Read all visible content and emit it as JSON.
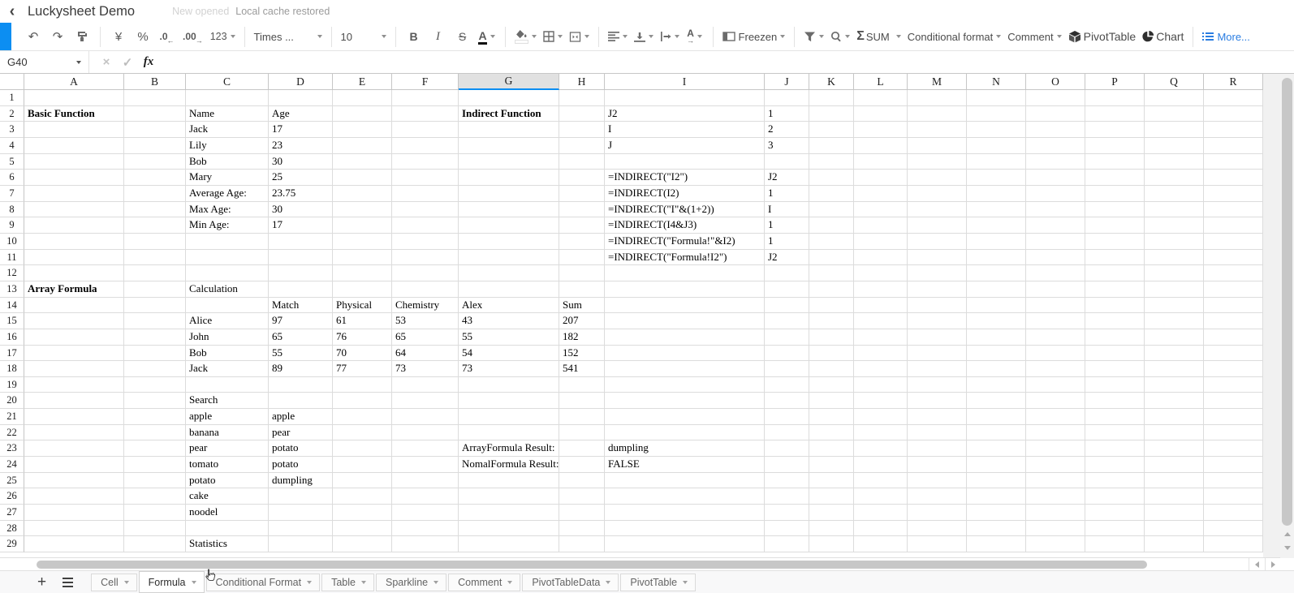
{
  "header": {
    "title": "Luckysheet Demo",
    "status_muted": "New opened",
    "status": "Local cache restored"
  },
  "icons": {
    "back": "‹",
    "undo": "↶",
    "redo": "↷",
    "currency": "¥",
    "percent": "%",
    "decimal_decrease": ".0",
    "decimal_increase": ".00",
    "arrow_left": "←",
    "arrow_right": "→",
    "number_format": "123",
    "bold": "B",
    "italic": "I",
    "strikethrough": "S",
    "font_color": "A",
    "text_rotate": "A",
    "sigma": "Σ",
    "cancel": "×",
    "confirm": "✓",
    "fx": "fx",
    "add_sheet": "+"
  },
  "toolbar": {
    "font_family": "Times ...",
    "font_size": "10",
    "freeze_label": "Freezen",
    "sum_label": "SUM",
    "conditional_label": "Conditional format",
    "comment_label": "Comment",
    "pivot_label": "PivotTable",
    "chart_label": "Chart",
    "more_label": "More..."
  },
  "formula_bar": {
    "name_box": "G40"
  },
  "grid": {
    "columns": [
      "A",
      "B",
      "C",
      "D",
      "E",
      "F",
      "G",
      "H",
      "I",
      "J",
      "K",
      "L",
      "M",
      "N",
      "O",
      "P",
      "Q",
      "R"
    ],
    "selected_column": "G",
    "row_count": 29,
    "cells": [
      {
        "r": 2,
        "c": "A",
        "v": "Basic Function",
        "b": true
      },
      {
        "r": 2,
        "c": "C",
        "v": "Name"
      },
      {
        "r": 2,
        "c": "D",
        "v": "Age"
      },
      {
        "r": 2,
        "c": "G",
        "v": "Indirect Function",
        "b": true
      },
      {
        "r": 2,
        "c": "I",
        "v": "J2"
      },
      {
        "r": 2,
        "c": "J",
        "v": "1"
      },
      {
        "r": 3,
        "c": "C",
        "v": "Jack"
      },
      {
        "r": 3,
        "c": "D",
        "v": "17"
      },
      {
        "r": 3,
        "c": "I",
        "v": "I"
      },
      {
        "r": 3,
        "c": "J",
        "v": "2"
      },
      {
        "r": 4,
        "c": "C",
        "v": "Lily"
      },
      {
        "r": 4,
        "c": "D",
        "v": "23"
      },
      {
        "r": 4,
        "c": "I",
        "v": "J"
      },
      {
        "r": 4,
        "c": "J",
        "v": "3"
      },
      {
        "r": 5,
        "c": "C",
        "v": "Bob"
      },
      {
        "r": 5,
        "c": "D",
        "v": "30"
      },
      {
        "r": 6,
        "c": "C",
        "v": "Mary"
      },
      {
        "r": 6,
        "c": "D",
        "v": "25"
      },
      {
        "r": 6,
        "c": "I",
        "v": "=INDIRECT(\"I2\")"
      },
      {
        "r": 6,
        "c": "J",
        "v": "J2"
      },
      {
        "r": 7,
        "c": "C",
        "v": "Average Age:"
      },
      {
        "r": 7,
        "c": "D",
        "v": "23.75"
      },
      {
        "r": 7,
        "c": "I",
        "v": "=INDIRECT(I2)"
      },
      {
        "r": 7,
        "c": "J",
        "v": "1"
      },
      {
        "r": 8,
        "c": "C",
        "v": "Max Age:"
      },
      {
        "r": 8,
        "c": "D",
        "v": "30"
      },
      {
        "r": 8,
        "c": "I",
        "v": "=INDIRECT(\"I\"&(1+2))"
      },
      {
        "r": 8,
        "c": "J",
        "v": "I"
      },
      {
        "r": 9,
        "c": "C",
        "v": "Min Age:"
      },
      {
        "r": 9,
        "c": "D",
        "v": "17"
      },
      {
        "r": 9,
        "c": "I",
        "v": "=INDIRECT(I4&J3)"
      },
      {
        "r": 9,
        "c": "J",
        "v": "1"
      },
      {
        "r": 10,
        "c": "I",
        "v": "=INDIRECT(\"Formula!\"&I2)"
      },
      {
        "r": 10,
        "c": "J",
        "v": "1"
      },
      {
        "r": 11,
        "c": "I",
        "v": "=INDIRECT(\"Formula!I2\")"
      },
      {
        "r": 11,
        "c": "J",
        "v": "J2"
      },
      {
        "r": 13,
        "c": "A",
        "v": "Array Formula",
        "b": true
      },
      {
        "r": 13,
        "c": "C",
        "v": "Calculation"
      },
      {
        "r": 14,
        "c": "D",
        "v": "Match"
      },
      {
        "r": 14,
        "c": "E",
        "v": "Physical"
      },
      {
        "r": 14,
        "c": "F",
        "v": "Chemistry"
      },
      {
        "r": 14,
        "c": "G",
        "v": "Alex"
      },
      {
        "r": 14,
        "c": "H",
        "v": "Sum"
      },
      {
        "r": 15,
        "c": "C",
        "v": "Alice"
      },
      {
        "r": 15,
        "c": "D",
        "v": "97"
      },
      {
        "r": 15,
        "c": "E",
        "v": "61"
      },
      {
        "r": 15,
        "c": "F",
        "v": "53"
      },
      {
        "r": 15,
        "c": "G",
        "v": "43"
      },
      {
        "r": 15,
        "c": "H",
        "v": "207"
      },
      {
        "r": 16,
        "c": "C",
        "v": "John"
      },
      {
        "r": 16,
        "c": "D",
        "v": "65"
      },
      {
        "r": 16,
        "c": "E",
        "v": "76"
      },
      {
        "r": 16,
        "c": "F",
        "v": "65"
      },
      {
        "r": 16,
        "c": "G",
        "v": "55"
      },
      {
        "r": 16,
        "c": "H",
        "v": "182"
      },
      {
        "r": 17,
        "c": "C",
        "v": "Bob"
      },
      {
        "r": 17,
        "c": "D",
        "v": "55"
      },
      {
        "r": 17,
        "c": "E",
        "v": "70"
      },
      {
        "r": 17,
        "c": "F",
        "v": "64"
      },
      {
        "r": 17,
        "c": "G",
        "v": "54"
      },
      {
        "r": 17,
        "c": "H",
        "v": "152"
      },
      {
        "r": 18,
        "c": "C",
        "v": "Jack"
      },
      {
        "r": 18,
        "c": "D",
        "v": "89"
      },
      {
        "r": 18,
        "c": "E",
        "v": "77"
      },
      {
        "r": 18,
        "c": "F",
        "v": "73"
      },
      {
        "r": 18,
        "c": "G",
        "v": "73"
      },
      {
        "r": 18,
        "c": "H",
        "v": "541"
      },
      {
        "r": 20,
        "c": "C",
        "v": "Search"
      },
      {
        "r": 21,
        "c": "C",
        "v": "apple"
      },
      {
        "r": 21,
        "c": "D",
        "v": "apple"
      },
      {
        "r": 22,
        "c": "C",
        "v": "banana"
      },
      {
        "r": 22,
        "c": "D",
        "v": "pear"
      },
      {
        "r": 23,
        "c": "C",
        "v": "pear"
      },
      {
        "r": 23,
        "c": "D",
        "v": "potato"
      },
      {
        "r": 23,
        "c": "G",
        "v": "ArrayFormula Result:"
      },
      {
        "r": 23,
        "c": "I",
        "v": "dumpling"
      },
      {
        "r": 24,
        "c": "C",
        "v": "tomato"
      },
      {
        "r": 24,
        "c": "D",
        "v": "potato"
      },
      {
        "r": 24,
        "c": "G",
        "v": "NomalFormula Result:"
      },
      {
        "r": 24,
        "c": "I",
        "v": "FALSE"
      },
      {
        "r": 25,
        "c": "C",
        "v": "potato"
      },
      {
        "r": 25,
        "c": "D",
        "v": "dumpling"
      },
      {
        "r": 26,
        "c": "C",
        "v": "cake"
      },
      {
        "r": 27,
        "c": "C",
        "v": "noodel"
      },
      {
        "r": 29,
        "c": "C",
        "v": "Statistics"
      }
    ]
  },
  "sheet_bar": {
    "tabs": [
      {
        "label": "Cell",
        "active": false
      },
      {
        "label": "Formula",
        "active": true
      },
      {
        "label": "Conditional Format",
        "active": false
      },
      {
        "label": "Table",
        "active": false
      },
      {
        "label": "Sparkline",
        "active": false
      },
      {
        "label": "Comment",
        "active": false
      },
      {
        "label": "PivotTableData",
        "active": false
      },
      {
        "label": "PivotTable",
        "active": false
      }
    ]
  },
  "colors": {
    "accent": "#0c8ef2",
    "link": "#2a7de2"
  }
}
